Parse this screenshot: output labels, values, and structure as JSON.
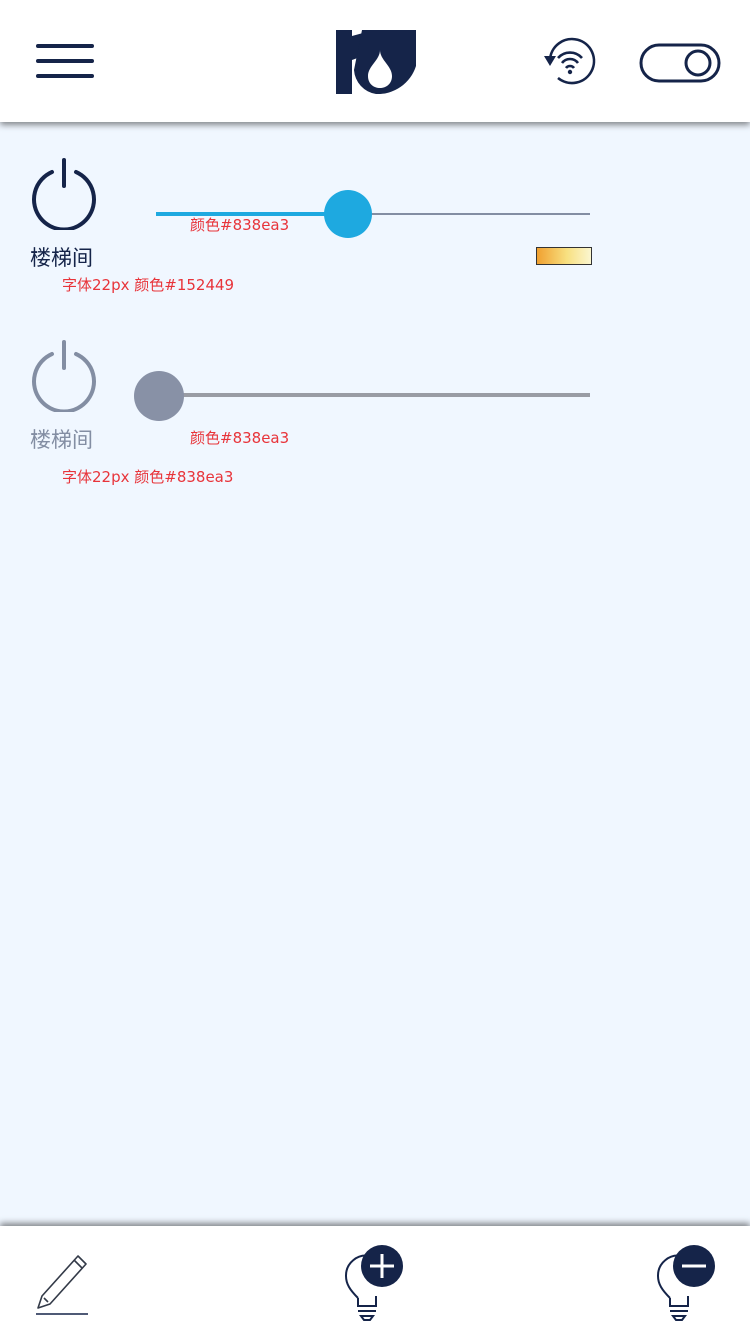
{
  "header": {
    "menu_icon": "menu-icon",
    "logo_icon": "brand-logo",
    "wifi_icon": "wifi-refresh-icon",
    "toggle_icon": "toggle-switch-icon"
  },
  "rooms": [
    {
      "label": "楼梯间",
      "power_on": true,
      "brightness": 0.45,
      "slider_annotation": "颜色#838ea3",
      "label_annotation": "字体22px  颜色#152449",
      "label_color": "#152449",
      "accent_color": "#1ea9e0"
    },
    {
      "label": "楼梯间",
      "power_on": false,
      "brightness": 0.0,
      "slider_annotation": "颜色#838ea3",
      "label_annotation": "字体22px  颜色#838ea3",
      "label_color": "#838ea3",
      "accent_color": "#838ea3"
    }
  ],
  "footer": {
    "edit_icon": "pencil-icon",
    "add_icon": "bulb-add-icon",
    "remove_icon": "bulb-remove-icon"
  },
  "colors": {
    "primary": "#152449",
    "accent": "#1ea9e0",
    "muted": "#838ea3",
    "background": "#f0f7ff",
    "annotation": "#e8343a"
  }
}
